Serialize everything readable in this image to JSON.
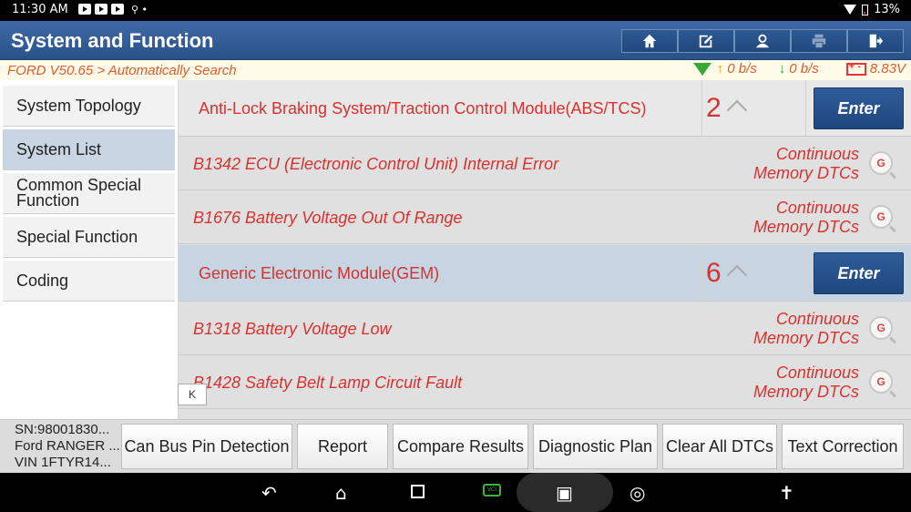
{
  "status_bar": {
    "time": "11:30 AM",
    "battery": "13%"
  },
  "header": {
    "title": "System and Function"
  },
  "toolbar": [
    {
      "name": "home-button",
      "icon": "home-icon"
    },
    {
      "name": "edit-button",
      "icon": "edit-icon"
    },
    {
      "name": "user-button",
      "icon": "user-icon"
    },
    {
      "name": "print-button",
      "icon": "print-icon"
    },
    {
      "name": "exit-button",
      "icon": "exit-icon"
    }
  ],
  "info_bar": {
    "breadcrumb": "FORD V50.65 > Automatically Search",
    "upload": "0 b/s",
    "download": "0 b/s",
    "voltage": "8.83V"
  },
  "sidebar": {
    "items": [
      {
        "label": "System Topology",
        "active": false
      },
      {
        "label": "System List",
        "active": true
      },
      {
        "label": "Common Special Function",
        "active": false
      },
      {
        "label": "Special Function",
        "active": false
      },
      {
        "label": "Coding",
        "active": false
      }
    ],
    "collapse_label": "K"
  },
  "modules": [
    {
      "name": "Anti-Lock Braking System/Traction Control Module(ABS/TCS)",
      "count": "2",
      "enter": "Enter",
      "dtcs": [
        {
          "code": "B1342 ECU (Electronic Control Unit) Internal Error",
          "status_line1": "Continuous",
          "status_line2": "Memory DTCs"
        },
        {
          "code": "B1676 Battery Voltage Out Of Range",
          "status_line1": "Continuous",
          "status_line2": "Memory DTCs"
        }
      ]
    },
    {
      "name": "Generic Electronic Module(GEM)",
      "count": "6",
      "enter": "Enter",
      "dtcs": [
        {
          "code": "B1318 Battery Voltage Low",
          "status_line1": "Continuous",
          "status_line2": "Memory DTCs"
        },
        {
          "code": "B1428 Safety Belt Lamp Circuit Fault",
          "status_line1": "Continuous",
          "status_line2": "Memory DTCs"
        }
      ]
    }
  ],
  "vehicle": {
    "sn": "SN:98001830...",
    "model": "Ford RANGER ...",
    "vin": "VIN 1FTYR14..."
  },
  "actions": {
    "can_bus": "Can Bus Pin Detection",
    "report": "Report",
    "compare": "Compare Results",
    "plan": "Diagnostic Plan",
    "clear": "Clear All DTCs",
    "text_correction": "Text Correction"
  },
  "nav": {
    "vci_label": "VCI"
  }
}
